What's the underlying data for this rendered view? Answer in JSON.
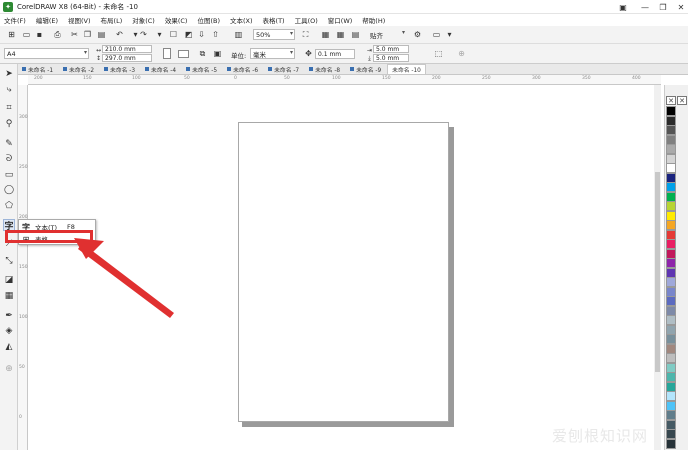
{
  "window": {
    "title": "CorelDRAW X8 (64-Bit) - 未命名 -10",
    "minimize_glyph": "—",
    "restore_glyph": "❐",
    "close_glyph": "✕",
    "logo_glyph": "✦"
  },
  "menu": [
    "文件(F)",
    "编辑(E)",
    "视图(V)",
    "布局(L)",
    "对象(C)",
    "效果(C)",
    "位图(B)",
    "文本(X)",
    "表格(T)",
    "工具(O)",
    "窗口(W)",
    "帮助(H)"
  ],
  "toolbar": {
    "zoom": "50%",
    "snap": "贴齐"
  },
  "property_bar": {
    "page_size": "A4",
    "width": "210.0 mm",
    "height": "297.0 mm",
    "units_label": "单位:",
    "units": "毫米",
    "nudge": "0.1 mm",
    "dup_x": "5.0 mm",
    "dup_y": "5.0 mm"
  },
  "tabs": [
    {
      "label": "未命名 -1",
      "active": false
    },
    {
      "label": "未命名 -2",
      "active": false
    },
    {
      "label": "未命名 -3",
      "active": false
    },
    {
      "label": "未命名 -4",
      "active": false
    },
    {
      "label": "未命名 -5",
      "active": false
    },
    {
      "label": "未命名 -6",
      "active": false
    },
    {
      "label": "未命名 -7",
      "active": false
    },
    {
      "label": "未命名 -8",
      "active": false
    },
    {
      "label": "未命名 -9",
      "active": false
    },
    {
      "label": "未命名 -10",
      "active": true
    }
  ],
  "ruler": {
    "h_ticks": [
      "200",
      "150",
      "100",
      "50",
      "0",
      "50",
      "100",
      "150",
      "200",
      "250",
      "300",
      "350",
      "400"
    ],
    "v_ticks": [
      "300",
      "250",
      "200",
      "150",
      "100",
      "50",
      "0"
    ]
  },
  "flyout": {
    "text_tool": "文本(T)",
    "text_shortcut": "F8",
    "table_tool": "表格"
  },
  "toolbox_glyphs": {
    "pick": "➤",
    "shape": "⤷",
    "crop": "⌗",
    "zoom": "⚲",
    "freehand": "✎",
    "artistic": "ᘐ",
    "rect": "▭",
    "ellipse": "◯",
    "polygon": "⬠",
    "text": "字",
    "text_alt": "字",
    "parallel": "⟋",
    "connector": "⤡",
    "dropshadow": "◪",
    "transparency": "▦",
    "eyedropper": "✒",
    "fill": "◈",
    "smartfill": "◭",
    "add": "⊕"
  },
  "palette": {
    "none_glyph": "✕",
    "colors": [
      "#000000",
      "#2b2b2b",
      "#555555",
      "#808080",
      "#aaaaaa",
      "#d4d4d4",
      "#ffffff",
      "#1a237e",
      "#00a0e9",
      "#00b050",
      "#b7d433",
      "#ffeb00",
      "#f5a623",
      "#e53935",
      "#e91e63",
      "#c2185b",
      "#8e24aa",
      "#5e35b1",
      "#9fa8da",
      "#7986cb",
      "#5c6bc0",
      "#7e8aa8",
      "#b0bec5",
      "#90a4ae",
      "#78909c",
      "#a1887f",
      "#bdbdbd",
      "#80cbc4",
      "#4db6ac",
      "#26a69a",
      "#b3e5fc",
      "#4fc3f7",
      "#607d8b",
      "#455a64",
      "#37474f",
      "#263238"
    ]
  },
  "watermark": "爱刨根知识网",
  "colors": {
    "highlight": "#e03030",
    "arrow": "#e03030"
  }
}
